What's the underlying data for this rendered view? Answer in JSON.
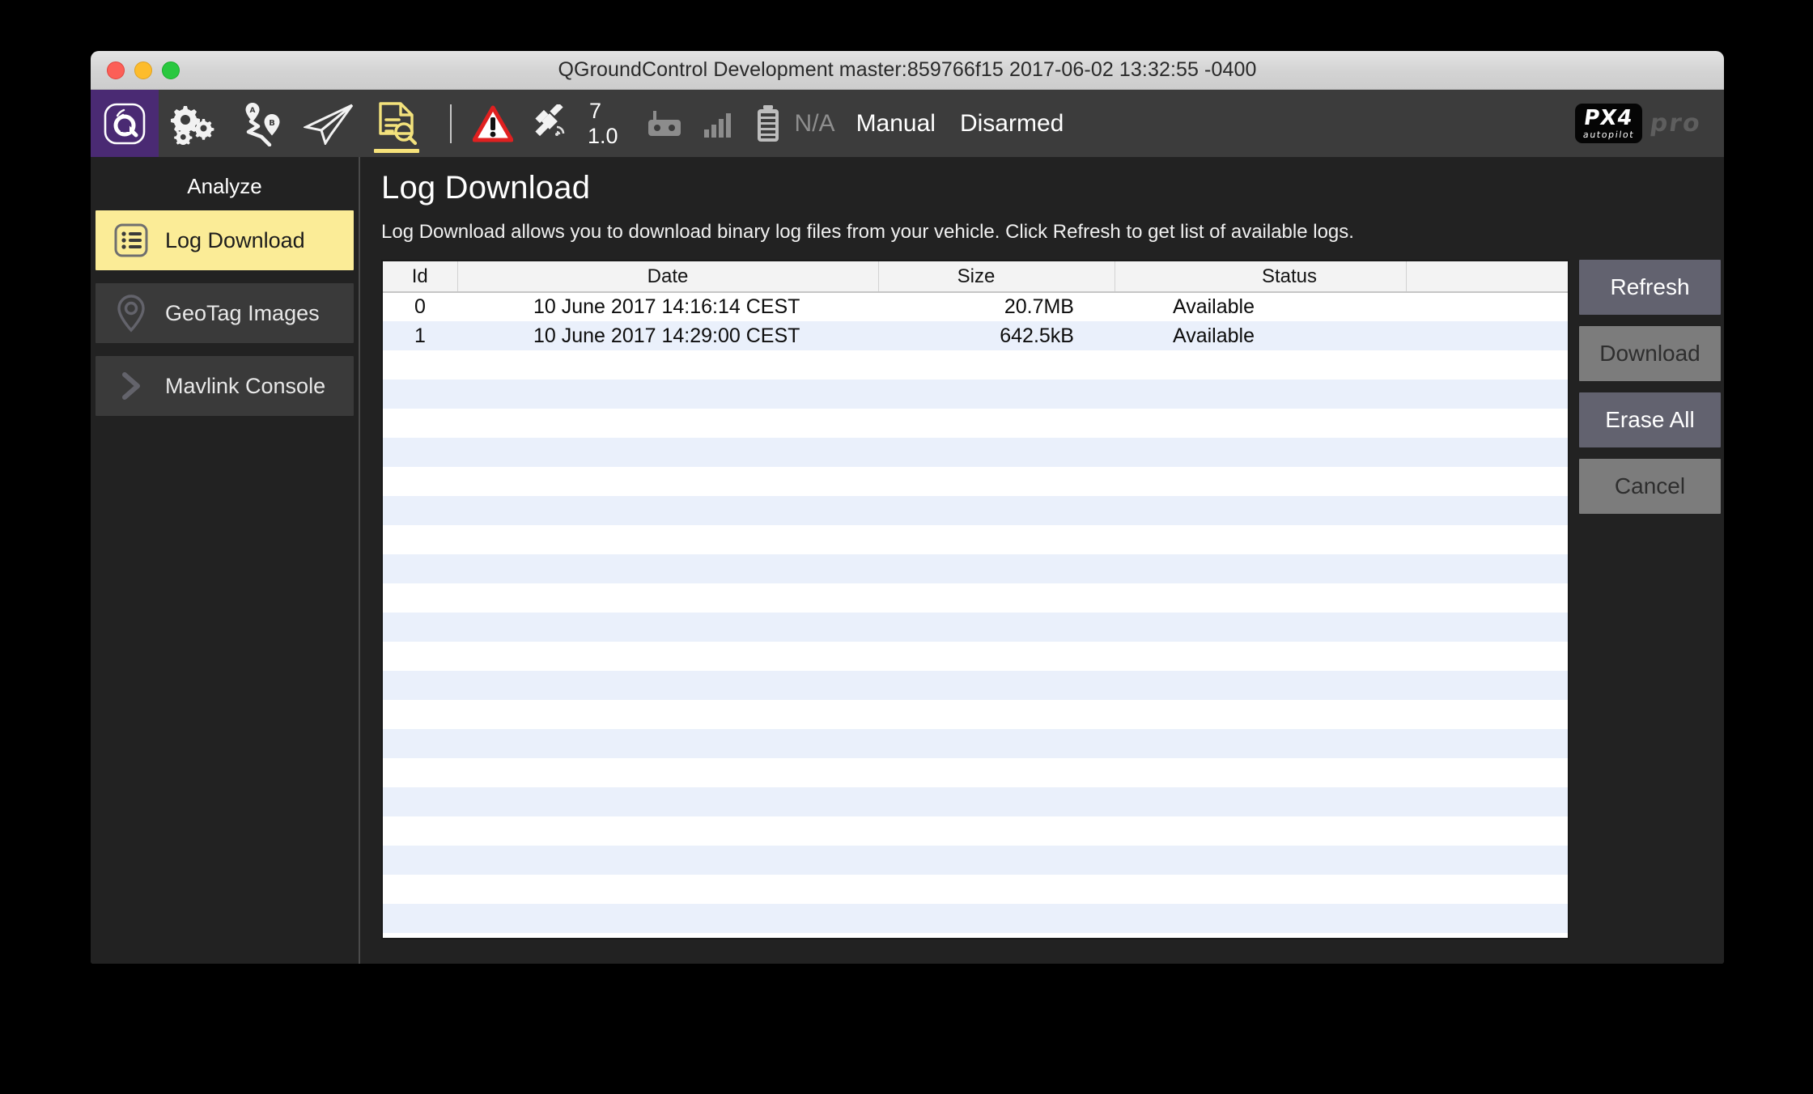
{
  "window": {
    "title": "QGroundControl Development master:859766f15 2017-06-02 13:32:55 -0400",
    "traffic_lights": [
      "close",
      "minimize",
      "maximize"
    ]
  },
  "toolbar": {
    "buttons": [
      {
        "name": "qgc-logo-icon",
        "label": "QGroundControl",
        "active": false
      },
      {
        "name": "gears-icon",
        "label": "Vehicle Setup",
        "active": false
      },
      {
        "name": "waypoints-ab-icon",
        "label": "Plan",
        "active": false
      },
      {
        "name": "paper-plane-icon",
        "label": "Fly",
        "active": false
      },
      {
        "name": "analyze-icon",
        "label": "Analyze",
        "active": true
      }
    ],
    "status": {
      "warning_icon": "warning-triangle-icon",
      "gps_icon": "satellite-icon",
      "gps_satellites": "7",
      "gps_hdop": "1.0",
      "rc_icon": "rc-transmitter-icon",
      "telemetry_icon": "signal-bars-icon",
      "battery_icon": "battery-icon",
      "battery_value": "N/A",
      "flight_mode": "Manual",
      "armed_state": "Disarmed"
    },
    "branding": {
      "px4_name": "PX4",
      "px4_sub": "autopilot",
      "pro": "pro"
    }
  },
  "sidebar": {
    "title": "Analyze",
    "items": [
      {
        "label": "Log Download",
        "icon": "list-icon",
        "selected": true
      },
      {
        "label": "GeoTag Images",
        "icon": "map-pin-icon",
        "selected": false
      },
      {
        "label": "Mavlink Console",
        "icon": "chevron-right-icon",
        "selected": false
      }
    ]
  },
  "main": {
    "title": "Log Download",
    "description": "Log Download allows you to download binary log files from your vehicle. Click Refresh to get list of available logs.",
    "table": {
      "columns": [
        "Id",
        "Date",
        "Size",
        "Status",
        ""
      ],
      "rows": [
        {
          "id": "0",
          "date": "10 June 2017 14:16:14 CEST",
          "size": "20.7MB",
          "status": "Available"
        },
        {
          "id": "1",
          "date": "10 June 2017 14:29:00 CEST",
          "size": "642.5kB",
          "status": "Available"
        }
      ],
      "empty_row_count": 22
    },
    "buttons": [
      {
        "label": "Refresh",
        "enabled": true
      },
      {
        "label": "Download",
        "enabled": false
      },
      {
        "label": "Erase All",
        "enabled": true
      },
      {
        "label": "Cancel",
        "enabled": false
      }
    ]
  },
  "colors": {
    "accent_yellow": "#fbec97",
    "toolbar_bg": "#3c3c3c",
    "logo_purple": "#4a2a73",
    "panel_bg": "#222222",
    "button_enabled": "#62626f",
    "button_disabled": "#7c7c7c",
    "row_stripe": "#eaf0fb",
    "warning_red": "#e02020"
  }
}
